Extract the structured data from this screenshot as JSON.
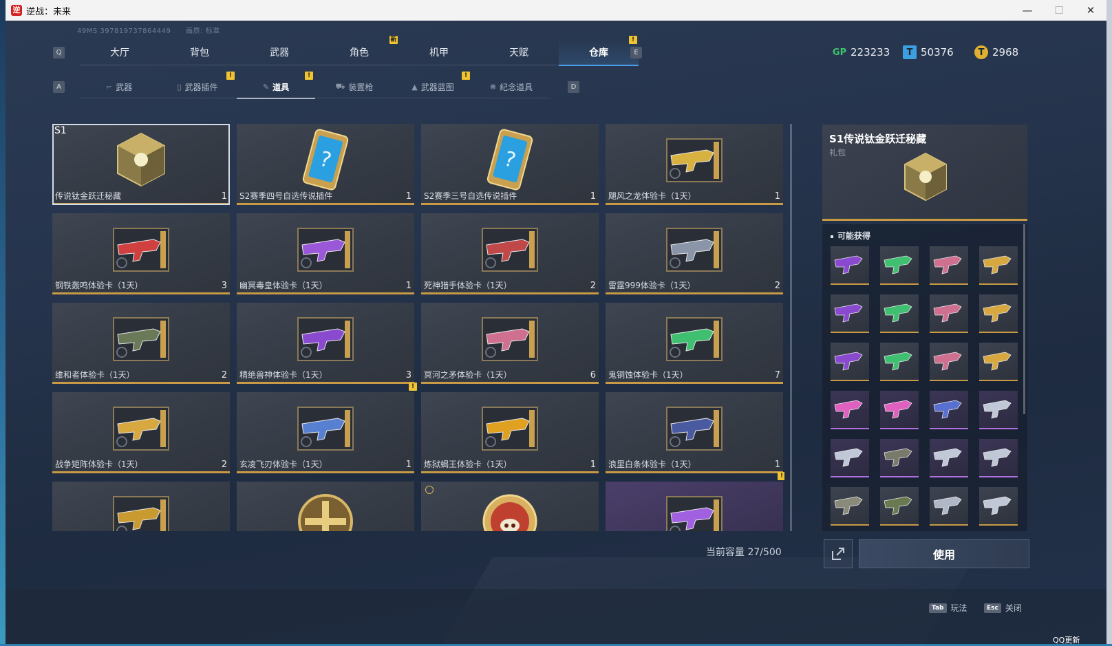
{
  "window": {
    "title": "逆战：未来",
    "logo_text": "逆",
    "minimize": "—",
    "maximize": "☐",
    "close": "✕"
  },
  "status": {
    "ping": "49MS  397819737864449",
    "quality": "画质: 标准"
  },
  "top_tabs": {
    "key_left": "Q",
    "key_right": "E",
    "items": [
      {
        "label": "大厅"
      },
      {
        "label": "背包"
      },
      {
        "label": "武器"
      },
      {
        "label": "角色",
        "badge": "新"
      },
      {
        "label": "机甲"
      },
      {
        "label": "天赋"
      },
      {
        "label": "仓库",
        "badge": "!",
        "active": true
      }
    ]
  },
  "currency": [
    {
      "icon": "gp-icon",
      "symbol": "GP",
      "value": "223233",
      "color": "#3fc46c"
    },
    {
      "icon": "ticket-icon",
      "symbol": "T",
      "value": "50376",
      "color": "#3e9fe0"
    },
    {
      "icon": "coin-icon",
      "symbol": "T",
      "value": "2968",
      "color": "#e0b030"
    }
  ],
  "sub_tabs": {
    "key_left": "A",
    "key_right": "D",
    "items": [
      {
        "label": "武器",
        "icon": "gun-icon"
      },
      {
        "label": "武器插件",
        "icon": "chip-icon",
        "badge": "!"
      },
      {
        "label": "道具",
        "icon": "item-icon",
        "badge": "!",
        "active": true
      },
      {
        "label": "装置枪",
        "icon": "device-gun-icon"
      },
      {
        "label": "武器蓝图",
        "icon": "blueprint-icon",
        "badge": "!"
      },
      {
        "label": "纪念道具",
        "icon": "medal-icon"
      }
    ]
  },
  "items": [
    {
      "name": "传说钛金跃迁秘藏",
      "count": "1",
      "tag": "S1",
      "art": "gold-cube"
    },
    {
      "name": "S2赛季四号自选传说插件",
      "count": "1",
      "art": "card"
    },
    {
      "name": "S2赛季三号自选传说插件",
      "count": "1",
      "art": "card"
    },
    {
      "name": "飓风之龙体验卡（1天）",
      "count": "1",
      "art": "gun",
      "color": "#d8b240"
    },
    {
      "name": "钢铁轰鸣体验卡（1天）",
      "count": "3",
      "art": "gun",
      "color": "#d04040"
    },
    {
      "name": "幽冥毒皇体验卡（1天）",
      "count": "1",
      "art": "gun",
      "color": "#9a58d8"
    },
    {
      "name": "死神猎手体验卡（1天）",
      "count": "2",
      "art": "gun",
      "color": "#c04848"
    },
    {
      "name": "雷霆999体验卡（1天）",
      "count": "2",
      "art": "gun",
      "color": "#8a96a8"
    },
    {
      "name": "维和者体验卡（1天）",
      "count": "2",
      "art": "gun",
      "color": "#6a7a58"
    },
    {
      "name": "精绝兽神体验卡（1天）",
      "count": "3",
      "art": "gun",
      "color": "#8a4ad0"
    },
    {
      "name": "冥河之矛体验卡（1天）",
      "count": "6",
      "art": "gun",
      "color": "#d07090"
    },
    {
      "name": "鬼铜蚀体验卡（1天）",
      "count": "7",
      "art": "gun",
      "color": "#3ec070"
    },
    {
      "name": "战争矩阵体验卡（1天）",
      "count": "2",
      "art": "gun",
      "color": "#d8a840"
    },
    {
      "name": "玄凌飞刃体验卡（1天）",
      "count": "1",
      "art": "gun",
      "color": "#5880d0",
      "badge": "!"
    },
    {
      "name": "炼狱蝎王体验卡（1天）",
      "count": "1",
      "art": "gun",
      "color": "#e0a020"
    },
    {
      "name": "浪里白条体验卡（1天）",
      "count": "1",
      "art": "gun",
      "color": "#4a5aa0"
    },
    {
      "name": "",
      "count": "",
      "art": "gun",
      "color": "#c89a30"
    },
    {
      "name": "",
      "count": "",
      "art": "medal"
    },
    {
      "name": "",
      "count": "",
      "art": "pig"
    },
    {
      "name": "",
      "count": "",
      "art": "gun",
      "color": "#a060e0",
      "purple": true,
      "badge": "!"
    }
  ],
  "capacity": "当前容量 27/500",
  "detail": {
    "title": "S1传说钛金跃迁秘藏",
    "subtitle": "礼包"
  },
  "rewards": {
    "title": "可能获得",
    "cells": [
      {
        "color": "#8a4ad0"
      },
      {
        "color": "#3ec070"
      },
      {
        "color": "#d07090"
      },
      {
        "color": "#d8a840"
      },
      {
        "color": "#8a4ad0"
      },
      {
        "color": "#3ec070"
      },
      {
        "color": "#d07090"
      },
      {
        "color": "#d8a840"
      },
      {
        "color": "#8a4ad0"
      },
      {
        "color": "#3ec070"
      },
      {
        "color": "#d07090"
      },
      {
        "color": "#d8a840"
      },
      {
        "color": "#e060c0",
        "purple": true
      },
      {
        "color": "#e060c0",
        "purple": true
      },
      {
        "color": "#5870d0",
        "purple": true
      },
      {
        "color": "#c0c8d8",
        "purple": true
      },
      {
        "color": "#c0c8d8",
        "purple": true
      },
      {
        "color": "#7a7a6a",
        "purple": true
      },
      {
        "color": "#c0c8d8",
        "purple": true
      },
      {
        "color": "#c0c8d8",
        "purple": true
      },
      {
        "color": "#8a8a7a"
      },
      {
        "color": "#6a7a50"
      },
      {
        "color": "#b0b8c8"
      },
      {
        "color": "#c0c8d8"
      }
    ]
  },
  "use_button": "使用",
  "hints": [
    {
      "key": "Tab",
      "label": "玩法"
    },
    {
      "key": "Esc",
      "label": "关闭"
    }
  ],
  "qq_update": "QQ更新"
}
